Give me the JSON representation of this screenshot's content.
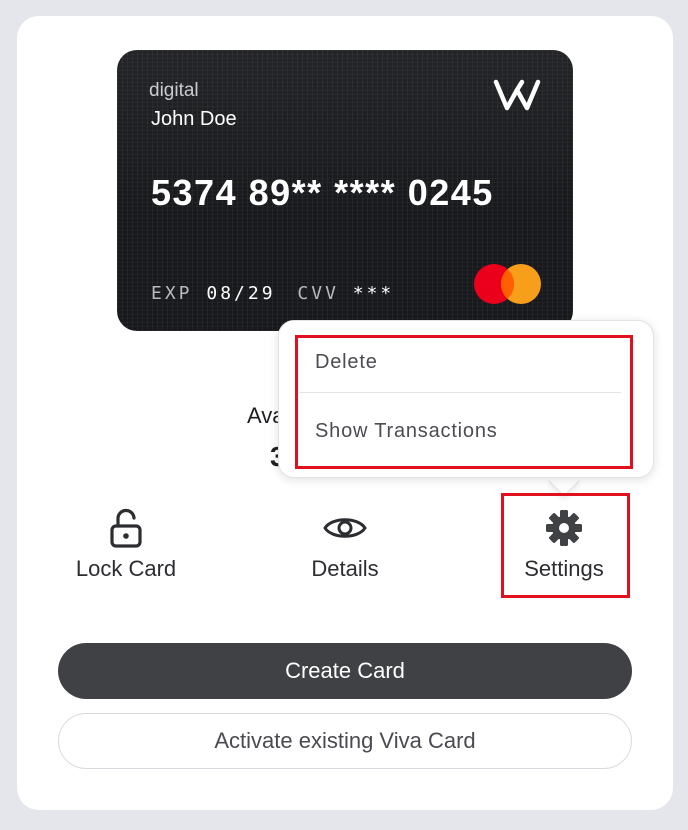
{
  "card": {
    "type": "digital",
    "holder": "John Doe",
    "number": "5374 89** **** 0245",
    "exp_label": "EXP",
    "exp_value": "08/29",
    "cvv_label": "CVV",
    "cvv_value": "***",
    "brand_logo": "viva-w-logo",
    "network_logo": "mastercard-logo",
    "network_colors": [
      "#eb001b",
      "#f79e1b"
    ]
  },
  "balance": {
    "label": "Ava",
    "value": "3"
  },
  "menu": {
    "items": [
      {
        "label": "Delete"
      },
      {
        "label": "Show Transactions"
      }
    ]
  },
  "actions": [
    {
      "label": "Lock Card",
      "icon": "unlock-icon"
    },
    {
      "label": "Details",
      "icon": "eye-icon"
    },
    {
      "label": "Settings",
      "icon": "gear-icon"
    }
  ],
  "buttons": {
    "create": "Create Card",
    "activate": "Activate existing Viva Card"
  },
  "colors": {
    "highlight": "#e0101e",
    "primary_button": "#404145"
  }
}
